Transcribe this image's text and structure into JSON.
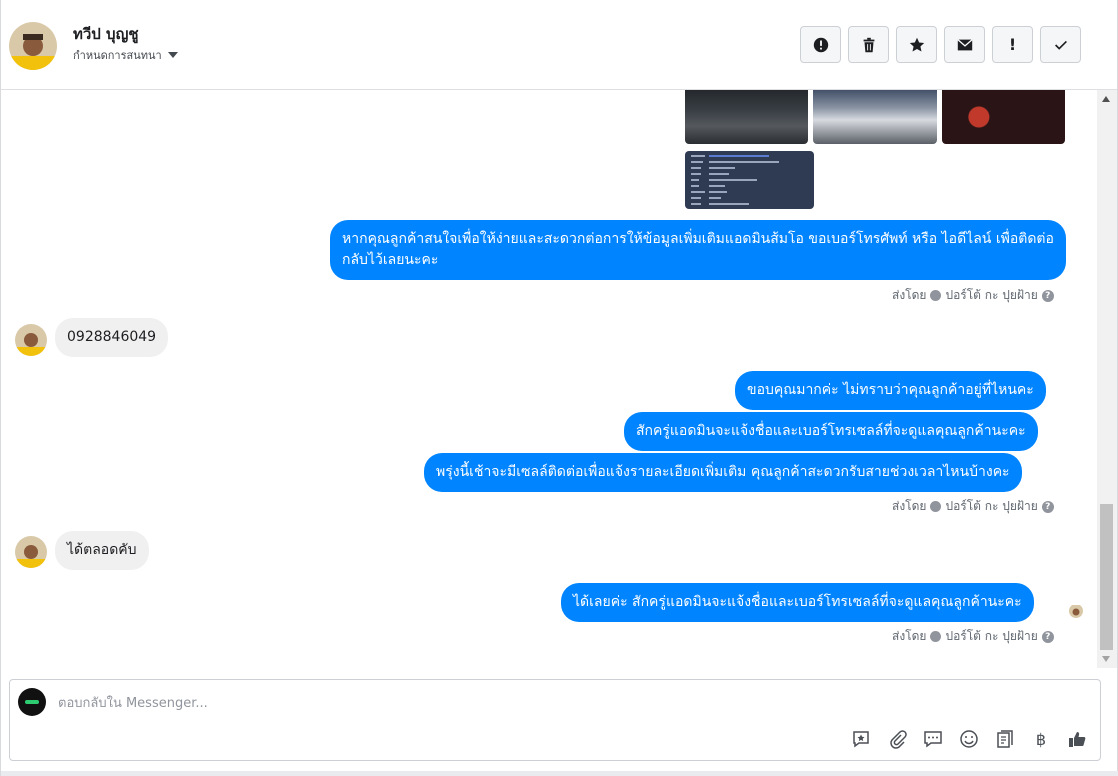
{
  "header": {
    "contact_name": "ทวีป บุญชู",
    "assign_label": "กำหนดการสนทนา",
    "actions": [
      {
        "name": "report-spam-button",
        "icon": "alert-circle-icon",
        "glyph": ""
      },
      {
        "name": "delete-button",
        "icon": "trash-icon",
        "glyph": ""
      },
      {
        "name": "star-button",
        "icon": "star-icon",
        "glyph": ""
      },
      {
        "name": "mark-unread-button",
        "icon": "envelope-icon",
        "glyph": ""
      },
      {
        "name": "follow-up-button",
        "icon": "exclamation-icon",
        "glyph": "!"
      },
      {
        "name": "mark-done-button",
        "icon": "check-icon",
        "glyph": ""
      }
    ]
  },
  "messages": {
    "out_1": "หากคุณลูกค้าสนใจเพื่อให้ง่ายและสะดวกต่อการให้ข้อมูลเพิ่มเติมแอดมินส้มโอ ขอเบอร์โทรศัพท์ หรือ ไอดีไลน์ เพื่อติดต่อกลับไว้เลยนะคะ",
    "in_1": "0928846049",
    "out_2": "ขอบคุณมากค่ะ ไม่ทราบว่าคุณลูกค้าอยู่ที่ไหนคะ",
    "out_3": "สักครู่แอดมินจะแจ้งชื่อและเบอร์โทรเซลล์ที่จะดูแลคุณลูกค้านะคะ",
    "out_4": "พรุ่งนี้เช้าจะมีเซลล์ติดต่อเพื่อแจ้งรายละเอียดเพิ่มเติม คุณลูกค้าสะดวกรับสายช่วงเวลาไหนบ้างคะ",
    "in_2": "ได้ตลอดคับ",
    "out_5": "ได้เลยค่ะ สักครู่แอดมินจะแจ้งชื่อและเบอร์โทรเซลล์ที่จะดูแลคุณลูกค้านะคะ"
  },
  "sent_by": {
    "prefix": "ส่งโดย",
    "agent": "ปอร์โต้ กะ ปุยฝ้าย",
    "help": "?"
  },
  "composer": {
    "placeholder": "ตอบกลับใน Messenger...",
    "tools": [
      "saved-reply-icon",
      "attachment-icon",
      "chat-bubble-icon",
      "emoji-icon",
      "receipt-icon",
      "baht-icon",
      "like-icon"
    ],
    "baht_symbol": "฿"
  },
  "colors": {
    "outgoing_bubble": "#0084ff",
    "incoming_bubble": "#f1f0f0",
    "meta_text": "#606770"
  }
}
